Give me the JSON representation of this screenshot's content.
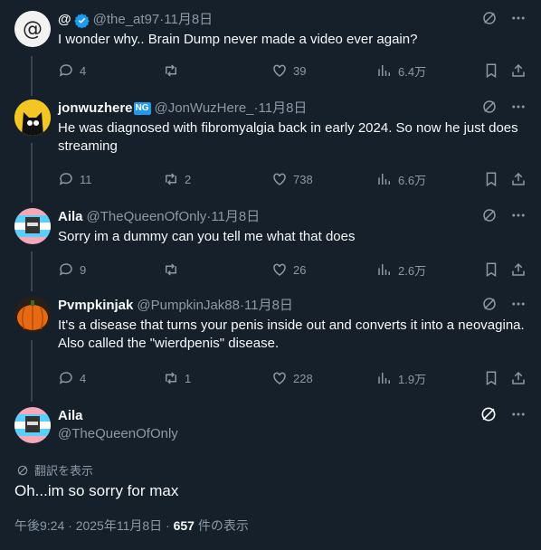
{
  "tweets": [
    {
      "name": "@",
      "handle": "@the_at97",
      "time": "11月8日",
      "text": "I wonder why.. Brain Dump never made a video ever again?",
      "replies": "4",
      "retweets": "",
      "likes": "39",
      "views": "6.4万"
    },
    {
      "name": "jonwuzhere",
      "badge": "NG",
      "handle": "@JonWuzHere_",
      "time": "11月8日",
      "text": "He was diagnosed with fibromyalgia back in early 2024. So now he just does streaming",
      "replies": "11",
      "retweets": "2",
      "likes": "738",
      "views": "6.6万"
    },
    {
      "name": "Aila",
      "handle": "@TheQueenOfOnly",
      "time": "11月8日",
      "text": "Sorry im a dummy can you tell me what that does",
      "replies": "9",
      "retweets": "",
      "likes": "26",
      "views": "2.6万"
    },
    {
      "name": "Pvmpkinjak",
      "handle": "@PumpkinJak88",
      "time": "11月8日",
      "text": "It's a disease that turns your penis inside out and converts it into a neovagina. Also called the \"wierdpenis\" disease.",
      "replies": "4",
      "retweets": "1",
      "likes": "228",
      "views": "1.9万"
    }
  ],
  "main": {
    "name": "Aila",
    "handle": "@TheQueenOfOnly",
    "translate": "翻訳を表示",
    "text": "Oh...im so sorry for max",
    "timestamp": "午後9:24 · 2025年11月8日 · ",
    "views_count": "657",
    "views_label": " 件の表示"
  },
  "separator": " · ",
  "colors": {
    "background": "#15202b",
    "text": "#f7f9f9",
    "muted": "#8b98a5",
    "accent": "#1d9bf0"
  }
}
